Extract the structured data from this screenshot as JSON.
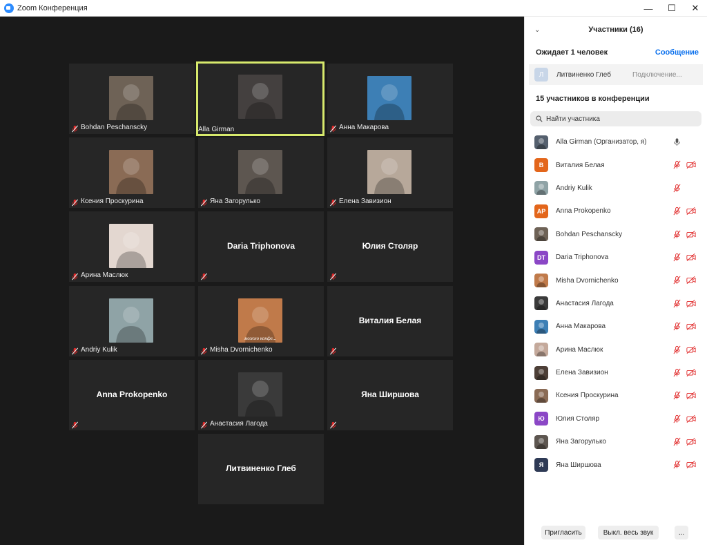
{
  "window": {
    "title": "Zoom Конференция",
    "minimize": "—",
    "maximize": "☐",
    "close": "✕"
  },
  "tiles": [
    {
      "name": "Bohdan Peschanscky",
      "photo": true,
      "muted": true,
      "active": false,
      "bg": "#6e6256"
    },
    {
      "name": "Alla Girman",
      "photo": true,
      "muted": false,
      "active": true,
      "bg": "#44403f"
    },
    {
      "name": "Анна Макарова",
      "photo": true,
      "muted": true,
      "active": false,
      "bg": "#3d7fb5"
    },
    {
      "name": "Ксения Проскурина",
      "photo": true,
      "muted": true,
      "active": false,
      "bg": "#8a6b55"
    },
    {
      "name": "Яна Загорулько",
      "photo": true,
      "muted": true,
      "active": false,
      "bg": "#5d5650"
    },
    {
      "name": "Елена Завизион",
      "photo": true,
      "muted": true,
      "active": false,
      "bg": "#b7a89a"
    },
    {
      "name": "Арина Маслюк",
      "photo": true,
      "muted": true,
      "active": false,
      "bg": "#e3d7d0"
    },
    {
      "name": "Daria Triphonova",
      "photo": false,
      "muted": true,
      "active": false
    },
    {
      "name": "Юлия Столяр",
      "photo": false,
      "muted": true,
      "active": false
    },
    {
      "name": "Andriy Kulik",
      "photo": true,
      "muted": true,
      "active": false,
      "bg": "#8fa3a6"
    },
    {
      "name": "Misha Dvornichenko",
      "photo": true,
      "muted": true,
      "active": false,
      "bg": "#c07a4a",
      "caption": "можно конфе..."
    },
    {
      "name": "Виталия Белая",
      "photo": false,
      "muted": true,
      "active": false
    },
    {
      "name": "Anna Prokopenko",
      "photo": false,
      "muted": true,
      "active": false
    },
    {
      "name": "Анастасия Лагода",
      "photo": true,
      "muted": true,
      "active": false,
      "bg": "#3a3a3a"
    },
    {
      "name": "Яна Ширшова",
      "photo": false,
      "muted": true,
      "active": false
    },
    {
      "name": "Литвиненко Глеб",
      "photo": false,
      "muted": false,
      "active": false
    }
  ],
  "panel": {
    "title": "Участники (16)",
    "waiting_label": "Ожидает 1 человек",
    "message_link": "Сообщение",
    "waiting_person": {
      "initial": "Л",
      "name": "Литвиненко Глеб",
      "status": "Подключение..."
    },
    "in_conference_label": "15 участников в конференции",
    "search_placeholder": "Найти участника",
    "participants": [
      {
        "name": "Alla Girman (Организатор, я)",
        "avatar_type": "photo",
        "color": "#55606e",
        "mic": "on",
        "video": "none"
      },
      {
        "name": "Виталия Белая",
        "avatar_type": "initials",
        "initials": "В",
        "color": "#e3661b",
        "mic": "muted",
        "video": "off"
      },
      {
        "name": "Andriy Kulik",
        "avatar_type": "photo",
        "color": "#8fa3a6",
        "mic": "muted",
        "video": "none"
      },
      {
        "name": "Anna Prokopenko",
        "avatar_type": "initials",
        "initials": "AP",
        "color": "#e3661b",
        "mic": "muted",
        "video": "off"
      },
      {
        "name": "Bohdan Peschanscky",
        "avatar_type": "photo",
        "color": "#6e6256",
        "mic": "muted",
        "video": "off"
      },
      {
        "name": "Daria Triphonova",
        "avatar_type": "initials",
        "initials": "DT",
        "color": "#8b47c6",
        "mic": "muted",
        "video": "off"
      },
      {
        "name": "Misha Dvornichenko",
        "avatar_type": "photo",
        "color": "#c07a4a",
        "mic": "muted",
        "video": "off"
      },
      {
        "name": "Анастасия Лагода",
        "avatar_type": "photo",
        "color": "#3a3a3a",
        "mic": "muted",
        "video": "off"
      },
      {
        "name": "Анна Макарова",
        "avatar_type": "photo",
        "color": "#3d7fb5",
        "mic": "muted",
        "video": "off"
      },
      {
        "name": "Арина Маслюк",
        "avatar_type": "photo",
        "color": "#c4a99b",
        "mic": "muted",
        "video": "off"
      },
      {
        "name": "Елена Завизион",
        "avatar_type": "photo",
        "color": "#4d3f37",
        "mic": "muted",
        "video": "off"
      },
      {
        "name": "Ксения Проскурина",
        "avatar_type": "photo",
        "color": "#8a6b55",
        "mic": "muted",
        "video": "off"
      },
      {
        "name": "Юлия Столяр",
        "avatar_type": "initials",
        "initials": "Ю",
        "color": "#8b47c6",
        "mic": "muted",
        "video": "off"
      },
      {
        "name": "Яна Загорулько",
        "avatar_type": "photo",
        "color": "#5d5650",
        "mic": "muted",
        "video": "off"
      },
      {
        "name": "Яна Ширшова",
        "avatar_type": "initials",
        "initials": "Я",
        "color": "#2e3a55",
        "mic": "muted",
        "video": "off"
      }
    ],
    "footer": {
      "invite": "Пригласить",
      "mute_all": "Выкл. весь звук",
      "more": "..."
    }
  },
  "colors": {
    "accent": "#0e72ed",
    "active_speaker": "#d7e96c",
    "muted_red": "#e02828"
  }
}
